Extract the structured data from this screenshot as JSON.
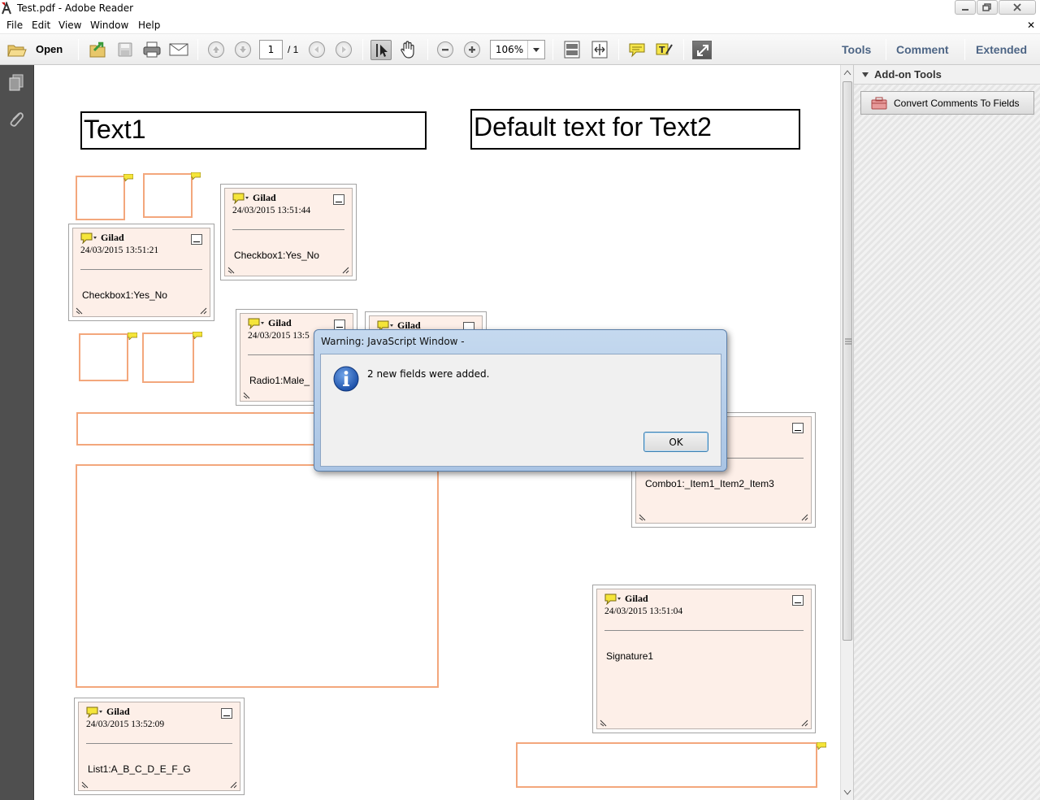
{
  "window": {
    "title": "Test.pdf - Adobe Reader",
    "controls": [
      "minimize",
      "restore",
      "close"
    ]
  },
  "menu": {
    "items": [
      "File",
      "Edit",
      "View",
      "Window",
      "Help"
    ],
    "close_glyph": "✕"
  },
  "toolbar": {
    "open_label": "Open",
    "page_current": "1",
    "page_total": "/ 1",
    "zoom": "106%",
    "pane_links": [
      "Tools",
      "Comment",
      "Extended"
    ]
  },
  "document": {
    "text1_value": "Text1",
    "text2_value": "Default text for Text2",
    "notes": [
      {
        "author": "Gilad",
        "date": "24/03/2015 13:51:44",
        "body": "Checkbox1:Yes_No"
      },
      {
        "author": "Gilad",
        "date": "24/03/2015 13:51:21",
        "body": "Checkbox1:Yes_No"
      },
      {
        "author": "Gilad",
        "date": "24/03/2015 13:5",
        "body": "Radio1:Male_"
      },
      {
        "author": "Gilad",
        "date": "",
        "body": ""
      },
      {
        "author": "",
        "date": "",
        "body": "Combo1:_Item1_Item2_Item3"
      },
      {
        "author": "Gilad",
        "date": "24/03/2015 13:51:04",
        "body": "Signature1"
      },
      {
        "author": "Gilad",
        "date": "24/03/2015 13:52:09",
        "body": "List1:A_B_C_D_E_F_G"
      }
    ]
  },
  "right_pane": {
    "section_title": "Add-on Tools",
    "convert_button": "Convert Comments To Fields"
  },
  "dialog": {
    "title": "Warning: JavaScript Window -",
    "message": "2 new fields were added.",
    "ok_label": "OK",
    "icon": "info-icon"
  },
  "colors": {
    "field_border": "#f3a77c",
    "note_bg": "#fdefe8",
    "pane_link": "#4d6585",
    "left_nav": "#4f4f4f"
  }
}
